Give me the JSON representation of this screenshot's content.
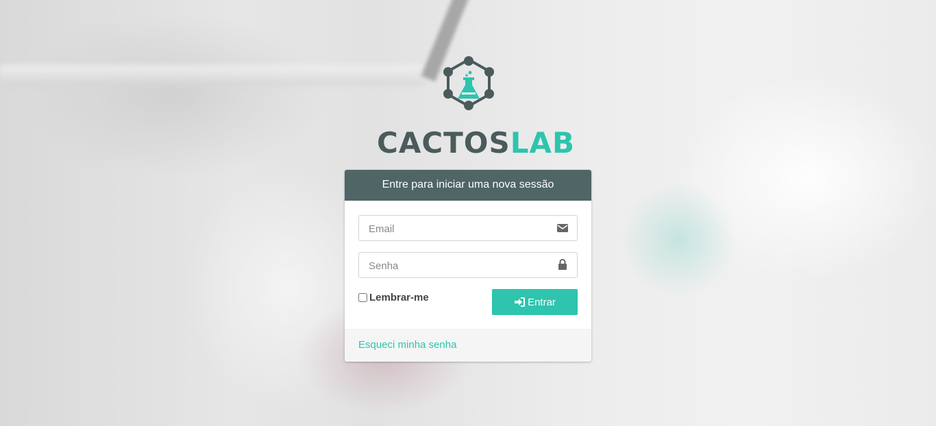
{
  "brand": {
    "part1": "CACTOS",
    "part2": "LAB",
    "logo_icon": "flask-hexagon-molecule-icon",
    "colors": {
      "dark": "#4b5b5c",
      "accent": "#2ec4ad"
    }
  },
  "login": {
    "header": "Entre para iniciar uma nova sessão",
    "email": {
      "placeholder": "Email",
      "value": "",
      "icon": "envelope-icon"
    },
    "password": {
      "placeholder": "Senha",
      "value": "",
      "icon": "lock-icon"
    },
    "remember_label": "Lembrar-me",
    "submit_label": "Entrar",
    "submit_icon": "sign-in-icon",
    "forgot_link": "Esqueci minha senha"
  }
}
